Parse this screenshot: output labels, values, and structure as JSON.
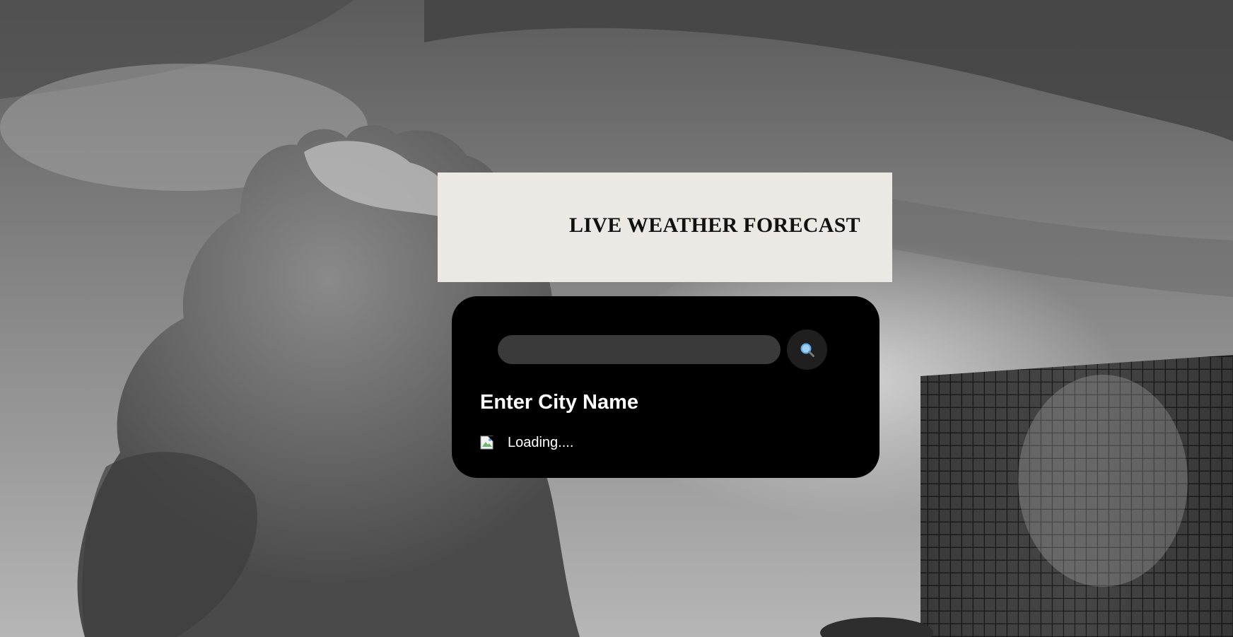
{
  "header": {
    "title": "LIVE WEATHER FORECAST"
  },
  "search": {
    "value": "",
    "placeholder": "",
    "button_icon": "search-icon"
  },
  "weather": {
    "city_heading": "Enter City Name",
    "status_text": "Loading....",
    "weather_icon": "broken-image-icon"
  },
  "background": {
    "description_icon": "cloudy-sky-with-building-photo"
  },
  "colors": {
    "header_bg": "#ece8e3",
    "card_bg": "#000000",
    "input_bg": "#3a3a3a",
    "button_bg": "#1f1f1f",
    "search_icon": "#5aa8e6"
  }
}
